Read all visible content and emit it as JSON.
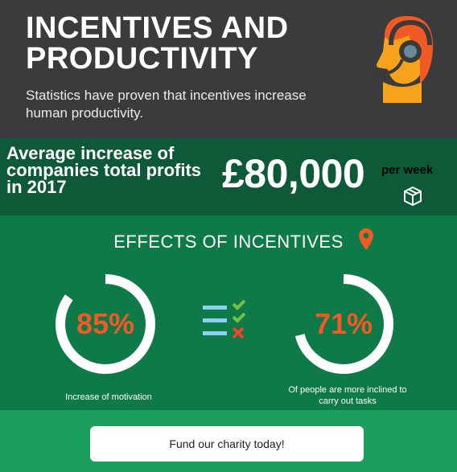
{
  "header": {
    "title_line1": "INCENTIVES AND",
    "title_line2": "PRODUCTIVITY",
    "subtitle": "Statistics have proven that incentives increase human productivity.",
    "avatar_icon": "headset-person-icon"
  },
  "profit": {
    "label_line1": "Average increase of",
    "label_line2": "companies total profits",
    "label_line3": "in 2017",
    "amount": "£80,000",
    "unit": "per week",
    "icon": "box-icon"
  },
  "effects": {
    "title": "EFFECTS OF INCENTIVES",
    "title_icon": "location-pin-icon",
    "stats": [
      {
        "percent": "85%",
        "value": 0.85,
        "caption": "Increase of motivation"
      },
      {
        "percent": "71%",
        "value": 0.71,
        "caption": "Of people are more inclined to carry out tasks"
      }
    ],
    "list_icon": "checklist-icon"
  },
  "cta": {
    "label": "Fund our charity today!"
  },
  "colors": {
    "header_bg": "#3b3b3d",
    "profit_bg": "#0e5a38",
    "effects_bg": "#0e7a47",
    "cta_bg": "#1a9e5c",
    "accent": "#f15a24"
  }
}
